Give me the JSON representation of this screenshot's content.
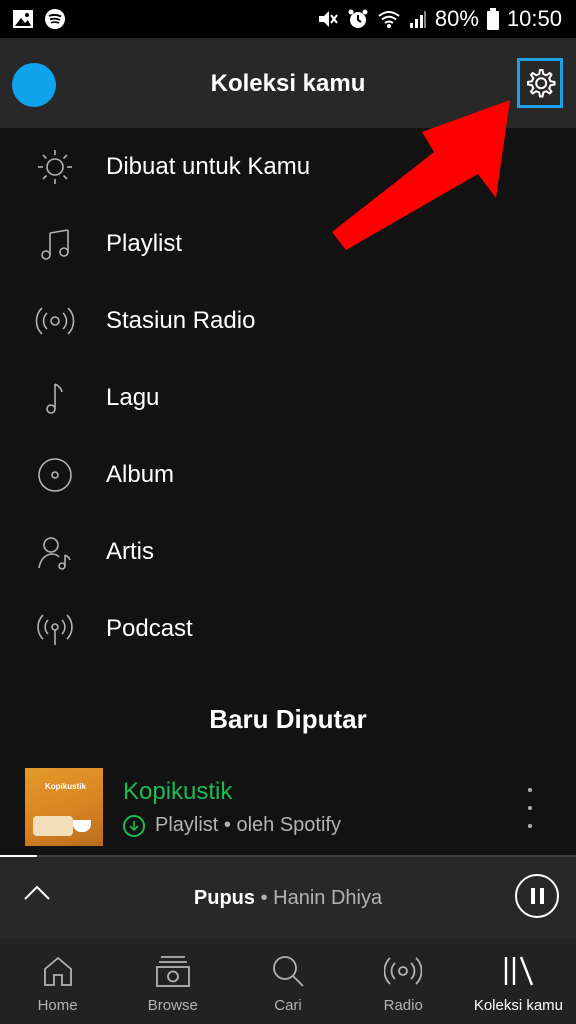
{
  "status_bar": {
    "battery": "80%",
    "time": "10:50"
  },
  "header": {
    "title": "Koleksi kamu"
  },
  "menu": [
    {
      "label": "Dibuat untuk Kamu",
      "icon": "sun-icon"
    },
    {
      "label": "Playlist",
      "icon": "music-notes-icon"
    },
    {
      "label": "Stasiun Radio",
      "icon": "radio-icon"
    },
    {
      "label": "Lagu",
      "icon": "music-note-icon"
    },
    {
      "label": "Album",
      "icon": "album-icon"
    },
    {
      "label": "Artis",
      "icon": "artist-icon"
    },
    {
      "label": "Podcast",
      "icon": "podcast-icon"
    }
  ],
  "recent": {
    "section_title": "Baru Diputar",
    "item": {
      "title": "Kopikustik",
      "subtitle": "Playlist • oleh Spotify",
      "cover_text": "Kopikustik"
    }
  },
  "now_playing": {
    "track": "Pupus",
    "separator": " • ",
    "artist": "Hanin Dhiya",
    "progress": 0.065
  },
  "bottom_nav": [
    {
      "label": "Home",
      "icon": "home-icon",
      "active": false
    },
    {
      "label": "Browse",
      "icon": "browse-icon",
      "active": false
    },
    {
      "label": "Cari",
      "icon": "search-icon",
      "active": false
    },
    {
      "label": "Radio",
      "icon": "radio-icon",
      "active": false
    },
    {
      "label": "Koleksi kamu",
      "icon": "library-icon",
      "active": true
    }
  ],
  "colors": {
    "accent": "#1db954",
    "highlight_box": "#1ea0e9",
    "arrow": "#ff0000",
    "avatar": "#0fa3ee"
  }
}
